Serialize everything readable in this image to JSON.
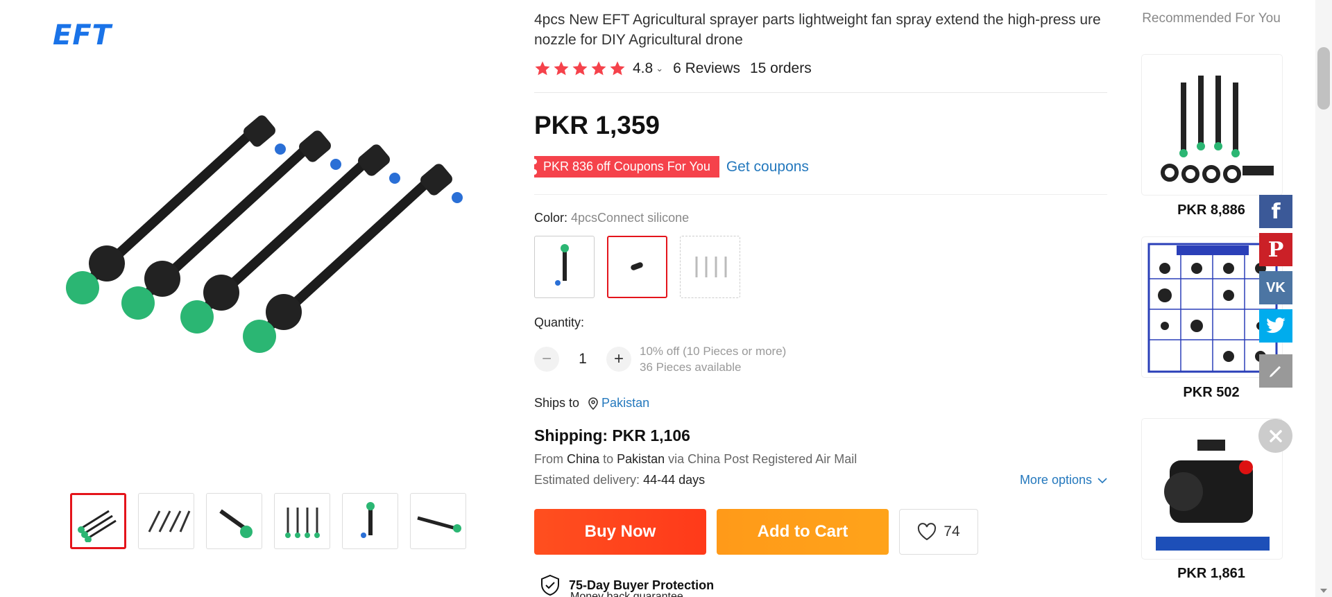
{
  "store": {
    "logo": "EFT"
  },
  "product": {
    "title": "4pcs New EFT Agricultural sprayer parts lightweight fan spray extend the high-press ure nozzle for DIY Agricultural drone",
    "rating": "4.8",
    "reviews": "6 Reviews",
    "orders": "15 orders",
    "price": "PKR 1,359",
    "coupon_tag": "PKR 836 off Coupons For You",
    "get_coupons": "Get coupons",
    "color_label": "Color:",
    "color_value": "4pcsConnect silicone",
    "quantity_label": "Quantity:",
    "quantity": "1",
    "bulk_discount": "10% off (10 Pieces or more)",
    "available": "36 Pieces available",
    "ships_to_label": "Ships to",
    "ships_to_country": "Pakistan",
    "shipping": "Shipping: PKR 1,106",
    "from_prefix": "From",
    "from_country": "China",
    "to_word": "to",
    "to_country": "Pakistan",
    "via_text": "via China Post Registered Air Mail",
    "est_prefix": "Estimated delivery:",
    "est_value": "44-44 days",
    "more_options": "More options",
    "buy_now": "Buy Now",
    "add_to_cart": "Add to Cart",
    "wishlist_count": "74",
    "protection": "75-Day Buyer Protection",
    "protection_sub": "Money back guarantee"
  },
  "recommended": {
    "title": "Recommended For You",
    "items": [
      {
        "price": "PKR 8,886"
      },
      {
        "price": "PKR 502"
      },
      {
        "price": "PKR 1,861"
      }
    ]
  },
  "share": {
    "facebook": "f",
    "pinterest": "P",
    "vk": "VK"
  },
  "colors": {
    "accent": "#e4141b",
    "link": "#2478bd",
    "buy": "#ff4f1f",
    "cart": "#ffa31a",
    "facebook": "#3b5998",
    "pinterest": "#cb2027",
    "vk": "#4c75a3",
    "twitter": "#00aced"
  }
}
